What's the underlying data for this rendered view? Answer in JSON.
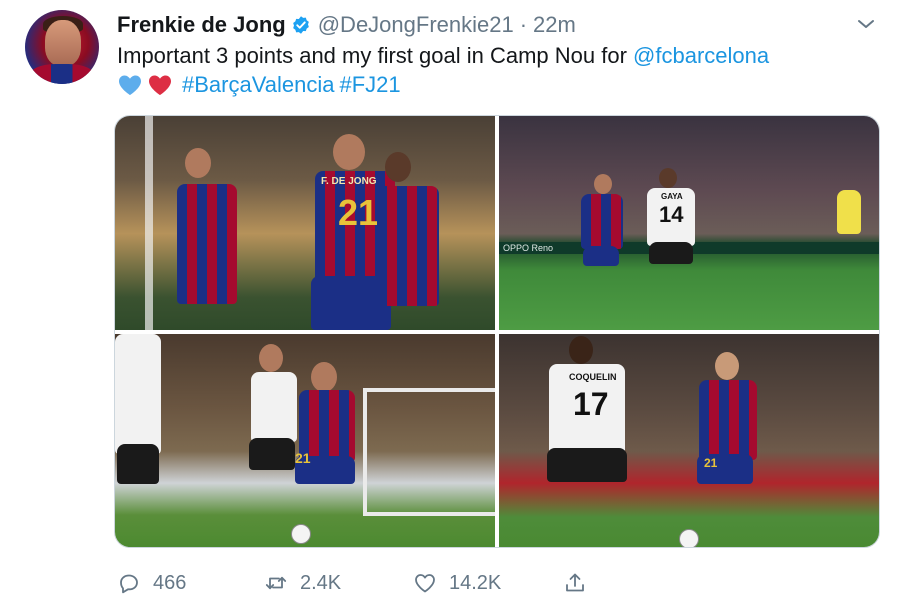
{
  "tweet": {
    "author_name": "Frenkie de Jong",
    "handle": "@DeJongFrenkie21",
    "separator": "·",
    "time": "22m",
    "text_line1": "Important 3 points and my first goal in Camp Nou for",
    "mention": "@fcbarcelona",
    "hashtag1": "#BarçaValencia",
    "hashtag2": "#FJ21",
    "emojis": [
      "blue-heart",
      "red-heart"
    ]
  },
  "photos": [
    {
      "jersey_front": "21",
      "name_on_back": "F. DE JONG"
    },
    {
      "jersey_back": "14",
      "name_on_back": "GAYA",
      "board_text": "OPPO Reno"
    },
    {
      "jersey_front": "21"
    },
    {
      "jersey_back": "17",
      "name_on_back": "COQUELIN",
      "jersey_front": "21"
    }
  ],
  "actions": {
    "replies": "466",
    "retweets": "2.4K",
    "likes": "14.2K"
  },
  "colors": {
    "link": "#1b95e0",
    "secondary_text": "#657786",
    "verified": "#1da1f2",
    "border": "#ccd6dd"
  }
}
